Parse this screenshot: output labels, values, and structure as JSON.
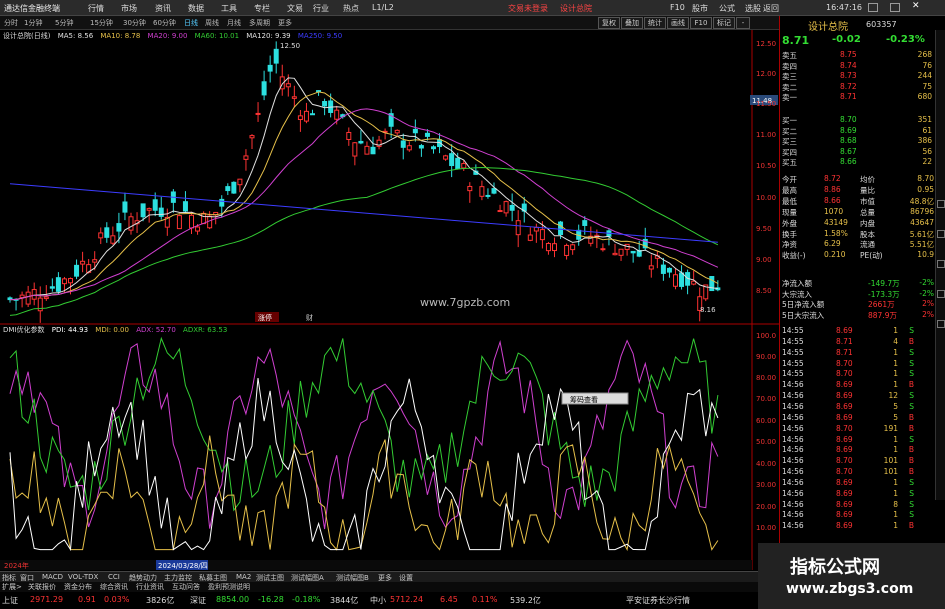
{
  "app": {
    "title": "通达信金融终端",
    "alert": "交易未登录",
    "stock_link": "设计总院"
  },
  "menu": {
    "items": [
      "行情",
      "市场",
      "资讯",
      "数据",
      "工具",
      "专栏",
      "文易",
      "行业",
      "热点",
      "L1/L2"
    ],
    "right": [
      "F10",
      "股市",
      "公式",
      "选股",
      "返回"
    ],
    "time": "16:47:16"
  },
  "toolbar": {
    "periods": [
      "分时",
      "1分钟",
      "5分钟",
      "15分钟",
      "30分钟",
      "60分钟",
      "日线",
      "周线",
      "月线",
      "多周期",
      "更多"
    ],
    "active": "日线",
    "right": [
      "复权",
      "叠加",
      "统计",
      "画线",
      "F10",
      "标记",
      "-"
    ]
  },
  "ma_legend": {
    "title": "设计总院(日线)",
    "items": [
      {
        "text": "MA5: 8.56",
        "color": "#e0e0e0"
      },
      {
        "text": "MA10: 8.78",
        "color": "#e6c04a"
      },
      {
        "text": "MA20: 9.00",
        "color": "#d040d0"
      },
      {
        "text": "MA60: 10.01",
        "color": "#33cc33"
      },
      {
        "text": "MA120: 9.39",
        "color": "#e0e0e0"
      },
      {
        "text": "MA250: 9.50",
        "color": "#3c3cff"
      }
    ]
  },
  "ind_legend": {
    "title": "DMI优化参数",
    "items": [
      {
        "text": "PDI: 44.93",
        "color": "#ffffff"
      },
      {
        "text": "MDI: 0.00",
        "color": "#e6c04a"
      },
      {
        "text": "ADX: 52.70",
        "color": "#d040d0"
      },
      {
        "text": "ADXR: 63.53",
        "color": "#33cc33"
      }
    ]
  },
  "price_axis": {
    "ticks": [
      "12.50",
      "12.00",
      "11.50",
      "11.00",
      "10.50",
      "10.00",
      "9.50",
      "9.00",
      "8.50"
    ],
    "current": "11.48"
  },
  "ind_axis": {
    "ticks": [
      "100.0",
      "90.00",
      "80.00",
      "70.00",
      "60.00",
      "50.00",
      "40.00",
      "30.00",
      "20.00",
      "10.00"
    ]
  },
  "chart_labels": {
    "high": "12.50",
    "low": "8.16",
    "site": "www.7gpzb.com",
    "event_a": "涨停",
    "event_b": "财",
    "date_left": "2024年",
    "date_mid": "2024/03/28/四",
    "popup": "筹码查看"
  },
  "quote": {
    "name": "设计总院",
    "code": "603357",
    "price": "8.71",
    "change": "-0.02",
    "pct": "-0.23%",
    "asks": [
      {
        "l": "卖五",
        "p": "8.75",
        "v": "268"
      },
      {
        "l": "卖四",
        "p": "8.74",
        "v": "76"
      },
      {
        "l": "卖三",
        "p": "8.73",
        "v": "244"
      },
      {
        "l": "卖二",
        "p": "8.72",
        "v": "75"
      },
      {
        "l": "卖一",
        "p": "8.71",
        "v": "680"
      }
    ],
    "bids": [
      {
        "l": "买一",
        "p": "8.70",
        "v": "351"
      },
      {
        "l": "买二",
        "p": "8.69",
        "v": "61"
      },
      {
        "l": "买三",
        "p": "8.68",
        "v": "386"
      },
      {
        "l": "买四",
        "p": "8.67",
        "v": "56"
      },
      {
        "l": "买五",
        "p": "8.66",
        "v": "22"
      }
    ],
    "stats": [
      {
        "a": "今开",
        "b": "8.72",
        "c": "均价",
        "d": "8.70"
      },
      {
        "a": "最高",
        "b": "8.86",
        "c": "量比",
        "d": "0.95"
      },
      {
        "a": "最低",
        "b": "8.66",
        "c": "市值",
        "d": "48.8亿"
      },
      {
        "a": "现量",
        "b": "1070",
        "c": "总量",
        "d": "86796"
      },
      {
        "a": "外盘",
        "b": "43149",
        "c": "内盘",
        "d": "43647"
      },
      {
        "a": "换手",
        "b": "1.58%",
        "c": "股本",
        "d": "5.61亿"
      },
      {
        "a": "净资",
        "b": "6.29",
        "c": "流通",
        "d": "5.51亿"
      },
      {
        "a": "收益(-)",
        "b": "0.210",
        "c": "PE(动)",
        "d": "10.9"
      }
    ],
    "flows": [
      {
        "l": "净流入额",
        "v": "-149.7万",
        "p": "-2%"
      },
      {
        "l": "大宗流入",
        "v": "-173.3万",
        "p": "-2%"
      },
      {
        "l": "5日净流入额",
        "v": "2661万",
        "p": "2%"
      },
      {
        "l": "5日大宗流入",
        "v": "887.9万",
        "p": "2%"
      }
    ],
    "ticks": [
      {
        "t": "14:55",
        "p": "8.69",
        "v": "1",
        "s": "S"
      },
      {
        "t": "14:55",
        "p": "8.71",
        "v": "4",
        "s": "B"
      },
      {
        "t": "14:55",
        "p": "8.71",
        "v": "1",
        "s": "S"
      },
      {
        "t": "14:55",
        "p": "8.70",
        "v": "1",
        "s": "S"
      },
      {
        "t": "14:55",
        "p": "8.70",
        "v": "1",
        "s": "S"
      },
      {
        "t": "14:56",
        "p": "8.69",
        "v": "1",
        "s": "B"
      },
      {
        "t": "14:56",
        "p": "8.69",
        "v": "12",
        "s": "S"
      },
      {
        "t": "14:56",
        "p": "8.69",
        "v": "5",
        "s": "S"
      },
      {
        "t": "14:56",
        "p": "8.69",
        "v": "5",
        "s": "B"
      },
      {
        "t": "14:56",
        "p": "8.70",
        "v": "191",
        "s": "B"
      },
      {
        "t": "14:56",
        "p": "8.69",
        "v": "1",
        "s": "S"
      },
      {
        "t": "14:56",
        "p": "8.69",
        "v": "1",
        "s": "B"
      },
      {
        "t": "14:56",
        "p": "8.70",
        "v": "101",
        "s": "B"
      },
      {
        "t": "14:56",
        "p": "8.70",
        "v": "101",
        "s": "B"
      },
      {
        "t": "14:56",
        "p": "8.69",
        "v": "1",
        "s": "S"
      },
      {
        "t": "14:56",
        "p": "8.69",
        "v": "1",
        "s": "S"
      },
      {
        "t": "14:56",
        "p": "8.69",
        "v": "8",
        "s": "S"
      },
      {
        "t": "14:56",
        "p": "8.69",
        "v": "1",
        "s": "S"
      },
      {
        "t": "14:56",
        "p": "8.69",
        "v": "1",
        "s": "B"
      }
    ]
  },
  "tabs": [
    "指标",
    "窗口",
    "MACD",
    "VOL-TDX",
    "CCI",
    "趋势动力",
    "主力监控",
    "私募主图",
    "MA2",
    "测试主图",
    "测试幅图A",
    "测试幅图B",
    "更多",
    "设置"
  ],
  "tabs2": [
    "扩展>",
    "关联报价",
    "资金分布",
    "综合资讯",
    "行业资讯",
    "互动问答",
    "盈利预测说明"
  ],
  "status": [
    {
      "n": "上证",
      "p": "2971.29",
      "c": "0.91",
      "pct": "0.03%",
      "v": "3826亿"
    },
    {
      "n": "深证",
      "p": "8854.00",
      "c": "-16.28",
      "pct": "-0.18%",
      "v": "3844亿"
    },
    {
      "n": "中小",
      "p": "5712.24",
      "c": "6.45",
      "pct": "0.11%",
      "v": "539.2亿"
    }
  ],
  "broker": "平安证券长沙行情",
  "watermark": {
    "title": "指标公式网",
    "url": "www.zbgs3.com"
  },
  "colors": {
    "up": "#ff3333",
    "down": "#2ce0e0",
    "panel_border": "#a00000"
  },
  "icons": [
    "settings-icon",
    "zoom-in-icon",
    "zoom-out-icon",
    "left-arrow-icon",
    "right-arrow-icon"
  ]
}
